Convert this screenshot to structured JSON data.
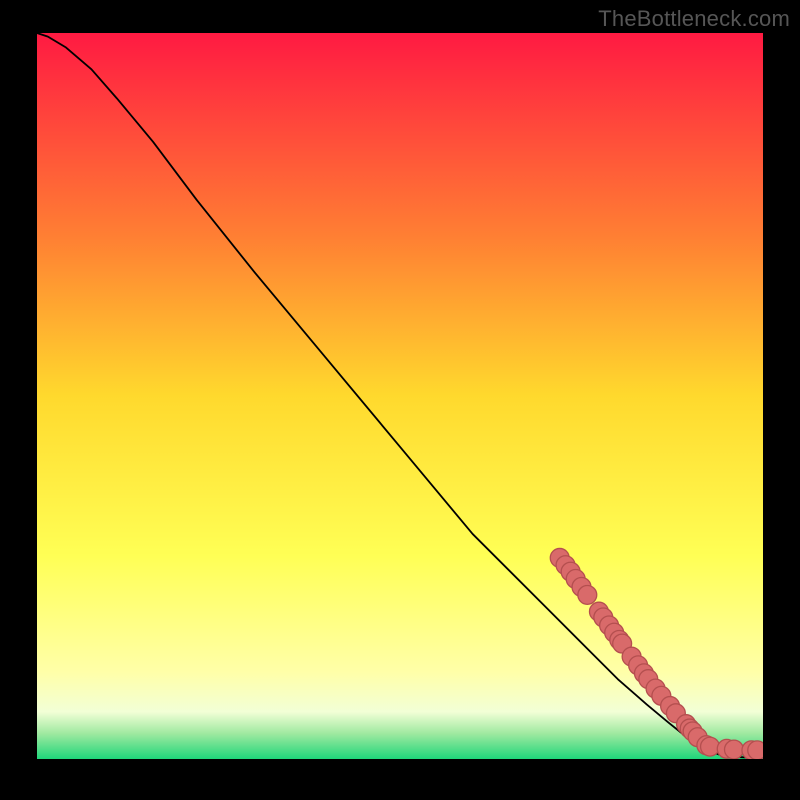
{
  "watermark": "TheBottleneck.com",
  "colors": {
    "frame_bg": "#000000",
    "gradient_top": "#ff1a42",
    "gradient_mid_upper": "#ff8a2f",
    "gradient_mid": "#ffd92d",
    "gradient_lower": "#ffff7a",
    "gradient_pale": "#f9ffd0",
    "gradient_bottom": "#1fd67a",
    "curve": "#000000",
    "points_fill": "#d96a6a",
    "points_stroke": "#b44f4f"
  },
  "chart_data": {
    "type": "line",
    "title": "",
    "xlabel": "",
    "ylabel": "",
    "xlim": [
      0,
      100
    ],
    "ylim": [
      0,
      100
    ],
    "gradient_stops": [
      {
        "offset": 0.0,
        "color": "#ff1a42"
      },
      {
        "offset": 0.28,
        "color": "#ff7f33"
      },
      {
        "offset": 0.5,
        "color": "#ffd92d"
      },
      {
        "offset": 0.72,
        "color": "#ffff55"
      },
      {
        "offset": 0.88,
        "color": "#ffffa8"
      },
      {
        "offset": 0.935,
        "color": "#f2ffd6"
      },
      {
        "offset": 0.965,
        "color": "#9fe9a0"
      },
      {
        "offset": 1.0,
        "color": "#1fd67a"
      }
    ],
    "curve": [
      {
        "x": 0.0,
        "y": 100.0
      },
      {
        "x": 1.5,
        "y": 99.5
      },
      {
        "x": 4.0,
        "y": 98.0
      },
      {
        "x": 7.5,
        "y": 95.0
      },
      {
        "x": 11.0,
        "y": 91.0
      },
      {
        "x": 16.0,
        "y": 85.0
      },
      {
        "x": 22.0,
        "y": 77.0
      },
      {
        "x": 30.0,
        "y": 67.0
      },
      {
        "x": 40.0,
        "y": 55.0
      },
      {
        "x": 50.0,
        "y": 43.0
      },
      {
        "x": 60.0,
        "y": 31.0
      },
      {
        "x": 70.0,
        "y": 21.0
      },
      {
        "x": 76.0,
        "y": 15.0
      },
      {
        "x": 80.0,
        "y": 11.0
      },
      {
        "x": 84.0,
        "y": 7.5
      },
      {
        "x": 87.0,
        "y": 5.0
      },
      {
        "x": 90.0,
        "y": 2.6
      },
      {
        "x": 92.0,
        "y": 1.3
      },
      {
        "x": 94.0,
        "y": 0.6
      },
      {
        "x": 96.0,
        "y": 0.3
      },
      {
        "x": 98.0,
        "y": 0.2
      },
      {
        "x": 100.0,
        "y": 0.2
      }
    ],
    "points": [
      {
        "x": 72.0,
        "y": 27.7
      },
      {
        "x": 72.8,
        "y": 26.7
      },
      {
        "x": 73.5,
        "y": 25.8
      },
      {
        "x": 74.2,
        "y": 24.8
      },
      {
        "x": 75.0,
        "y": 23.7
      },
      {
        "x": 75.8,
        "y": 22.6
      },
      {
        "x": 77.4,
        "y": 20.3
      },
      {
        "x": 78.0,
        "y": 19.5
      },
      {
        "x": 78.8,
        "y": 18.4
      },
      {
        "x": 79.5,
        "y": 17.4
      },
      {
        "x": 80.2,
        "y": 16.4
      },
      {
        "x": 80.6,
        "y": 15.9
      },
      {
        "x": 81.9,
        "y": 14.1
      },
      {
        "x": 82.8,
        "y": 12.9
      },
      {
        "x": 83.6,
        "y": 11.8
      },
      {
        "x": 84.2,
        "y": 11.0
      },
      {
        "x": 85.2,
        "y": 9.7
      },
      {
        "x": 86.0,
        "y": 8.7
      },
      {
        "x": 87.2,
        "y": 7.3
      },
      {
        "x": 88.0,
        "y": 6.3
      },
      {
        "x": 89.4,
        "y": 4.8
      },
      {
        "x": 89.9,
        "y": 4.2
      },
      {
        "x": 90.3,
        "y": 3.8
      },
      {
        "x": 91.0,
        "y": 3.0
      },
      {
        "x": 92.2,
        "y": 1.9
      },
      {
        "x": 92.7,
        "y": 1.7
      },
      {
        "x": 95.0,
        "y": 1.4
      },
      {
        "x": 96.0,
        "y": 1.3
      },
      {
        "x": 98.4,
        "y": 1.2
      },
      {
        "x": 99.2,
        "y": 1.2
      }
    ],
    "point_radius": 1.3
  }
}
